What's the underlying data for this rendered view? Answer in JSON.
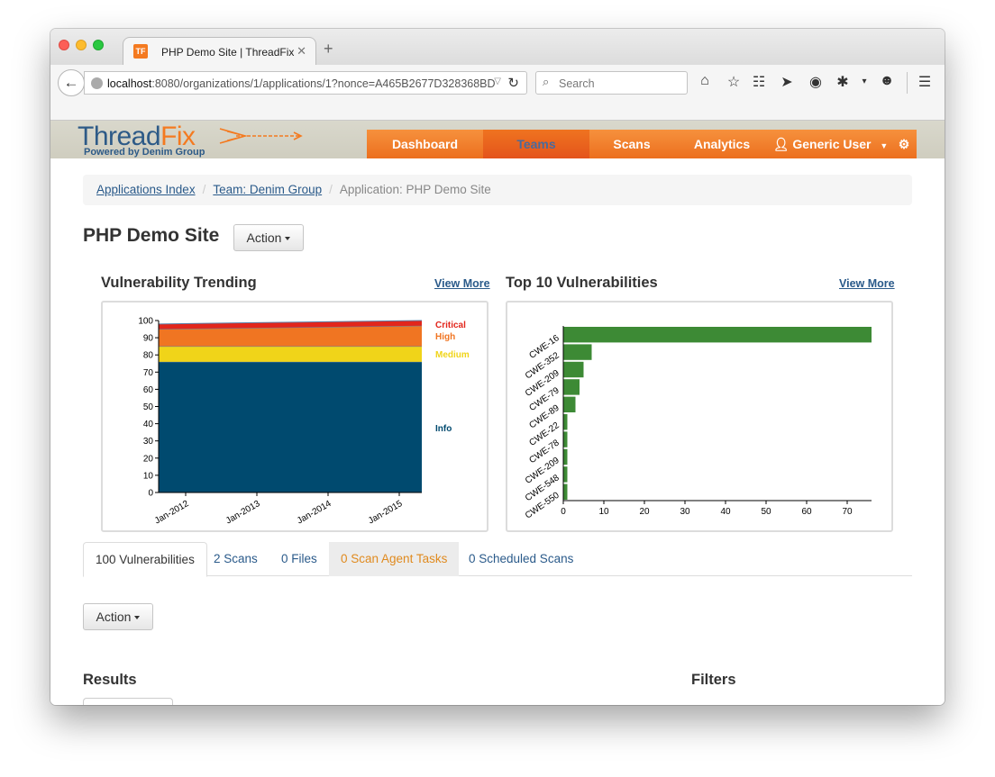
{
  "browser": {
    "tab_title": "PHP Demo Site | ThreadFix",
    "tab_icon_text": "TF",
    "url_host": "localhost",
    "url_rest": ":8080/organizations/1/applications/1?nonce=A465B2677D328368BD",
    "search_placeholder": "Search",
    "toolbar_icons": [
      "home-icon",
      "bookmark-star-icon",
      "reading-list-icon",
      "send-icon",
      "pocket-icon",
      "extension-icon",
      "emoji-icon",
      "hamburger-menu-icon"
    ]
  },
  "header": {
    "logo_thread": "Thread",
    "logo_fix": "Fix",
    "logo_sub": "Powered by Denim Group",
    "menu": [
      "Dashboard",
      "Teams",
      "Scans",
      "Analytics",
      "Generic User"
    ],
    "active_menu": "Teams"
  },
  "breadcrumb": {
    "item1": "Applications Index",
    "item2": "Team: Denim Group",
    "current": "Application: PHP Demo Site"
  },
  "page": {
    "title": "PHP Demo Site",
    "action_label": "Action",
    "trend_title": "Vulnerability Trending",
    "top10_title": "Top 10 Vulnerabilities",
    "view_more": "View More"
  },
  "tabs": [
    "100 Vulnerabilities",
    "2 Scans",
    "0 Files",
    "0 Scan Agent Tasks",
    "0 Scheduled Scans"
  ],
  "lower": {
    "action_label": "Action",
    "results_title": "Results",
    "filters_title": "Filters"
  },
  "colors": {
    "critical": "#e2261c",
    "high": "#f07522",
    "medium": "#f0d419",
    "info": "#004a6f",
    "bar": "#3d8a35",
    "brand_orange": "#f47a20"
  },
  "chart_data": [
    {
      "type": "area",
      "stacked": true,
      "x": [
        "Jan-2012",
        "Jan-2015"
      ],
      "x_ticks": [
        "Jan-2012",
        "Jan-2013",
        "Jan-2014",
        "Jan-2015"
      ],
      "y_ticks": [
        0,
        10,
        20,
        30,
        40,
        50,
        60,
        70,
        80,
        90,
        100
      ],
      "ylim": [
        0,
        100
      ],
      "series": [
        {
          "name": "Info",
          "values": [
            76,
            76
          ]
        },
        {
          "name": "Medium",
          "values": [
            9,
            9
          ]
        },
        {
          "name": "High",
          "values": [
            10,
            12
          ]
        },
        {
          "name": "Critical",
          "values": [
            3,
            3
          ]
        }
      ],
      "legend": [
        "Critical",
        "High",
        "Medium",
        "Info"
      ]
    },
    {
      "type": "bar",
      "orientation": "horizontal",
      "categories": [
        "CWE-16",
        "CWE-352",
        "CWE-209",
        "CWE-79",
        "CWE-89",
        "CWE-22",
        "CWE-78",
        "CWE-209",
        "CWE-548",
        "CWE-550"
      ],
      "values": [
        76,
        7,
        5,
        4,
        3,
        1,
        1,
        1,
        1,
        1
      ],
      "x_ticks": [
        0,
        10,
        20,
        30,
        40,
        50,
        60,
        70
      ],
      "xlim": [
        0,
        76
      ]
    }
  ]
}
